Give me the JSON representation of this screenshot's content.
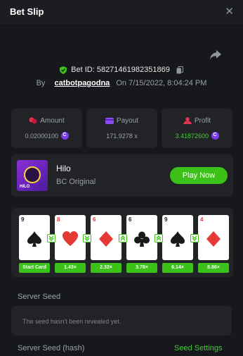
{
  "header": {
    "title": "Bet Slip",
    "close_icon": "close-icon"
  },
  "bet": {
    "id_label": "Bet ID:",
    "id_value": "58271461982351869",
    "by_label": "By",
    "username": "catbotpagodna",
    "on_label": "On",
    "datetime": "7/15/2022, 8:04:24 PM"
  },
  "stats": {
    "amount": {
      "label": "Amount",
      "value": "0.02000100",
      "icon": "coins-icon"
    },
    "payout": {
      "label": "Payout",
      "value": "171.9278 x",
      "icon": "wallet-icon"
    },
    "profit": {
      "label": "Profit",
      "value": "3.41872600",
      "icon": "profit-icon"
    }
  },
  "game": {
    "name": "Hilo",
    "subtitle": "BC Original",
    "play_label": "Play Now",
    "thumb_text": "HILO"
  },
  "cards": [
    {
      "rank": "9",
      "suit": "spade",
      "multiplier": "Start Card"
    },
    {
      "rank": "8",
      "suit": "heart",
      "multiplier": "1.43×"
    },
    {
      "rank": "6",
      "suit": "diamond",
      "multiplier": "2.32×"
    },
    {
      "rank": "6",
      "suit": "club",
      "multiplier": "3.78×"
    },
    {
      "rank": "9",
      "suit": "spade",
      "multiplier": "6.14×"
    },
    {
      "rank": "4",
      "suit": "diamond",
      "multiplier": "8.86×"
    }
  ],
  "arrows": [
    "lower",
    "lower",
    "higher",
    "higher",
    "lower"
  ],
  "seed": {
    "server_seed_label": "Server Seed",
    "server_seed_text": "The seed hasn't been revealed yet.",
    "server_seed_hash_label": "Server Seed (hash)",
    "seed_settings_label": "Seed Settings"
  },
  "colors": {
    "accent_green": "#3bc117",
    "background": "#17181b",
    "panel": "#222327",
    "red": "#e53935",
    "purple": "#7a3cf0"
  }
}
